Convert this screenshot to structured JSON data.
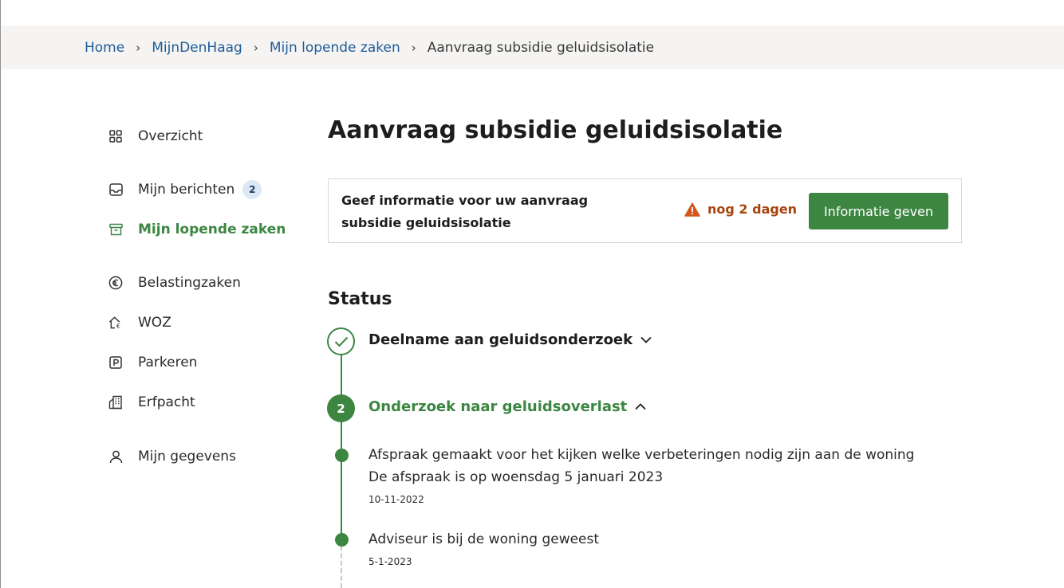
{
  "breadcrumb": {
    "items": [
      "Home",
      "MijnDenHaag",
      "Mijn lopende zaken"
    ],
    "current": "Aanvraag subsidie geluidsisolatie"
  },
  "sidebar": {
    "items": [
      {
        "label": "Overzicht",
        "icon": "grid-icon"
      },
      {
        "label": "Mijn berichten",
        "icon": "inbox-icon",
        "badge": "2"
      },
      {
        "label": "Mijn lopende zaken",
        "icon": "archive-icon",
        "active": true
      },
      {
        "label": "Belastingzaken",
        "icon": "euro-icon"
      },
      {
        "label": "WOZ",
        "icon": "house-value-icon"
      },
      {
        "label": "Parkeren",
        "icon": "parking-icon"
      },
      {
        "label": "Erfpacht",
        "icon": "building-icon"
      },
      {
        "label": "Mijn gegevens",
        "icon": "user-icon"
      }
    ]
  },
  "main": {
    "title": "Aanvraag subsidie geluidsisolatie",
    "task": {
      "text": "Geef informatie voor uw aanvraag subsidie geluidsisolatie",
      "deadline": "nog 2 dagen",
      "button": "Informatie geven"
    },
    "status": {
      "heading": "Status",
      "steps": [
        {
          "title": "Deelname aan geluidsonderzoek",
          "state": "done"
        },
        {
          "number": "2",
          "title": "Onderzoek naar geluidsoverlast",
          "state": "current",
          "events": [
            {
              "text": "Afspraak gemaakt voor het kijken welke verbeteringen nodig zijn aan de woning",
              "detail": "De afspraak is op woensdag 5 januari 2023",
              "date": "10-11-2022"
            },
            {
              "text": "Adviseur is bij de woning geweest",
              "date": "5-1-2023"
            }
          ]
        }
      ]
    }
  },
  "colors": {
    "accent": "#3c8642",
    "link": "#1f5c99",
    "warning": "#a6440b",
    "breadcrumb_bg": "#f5f4f2",
    "badge_bg": "#dde8f6"
  }
}
